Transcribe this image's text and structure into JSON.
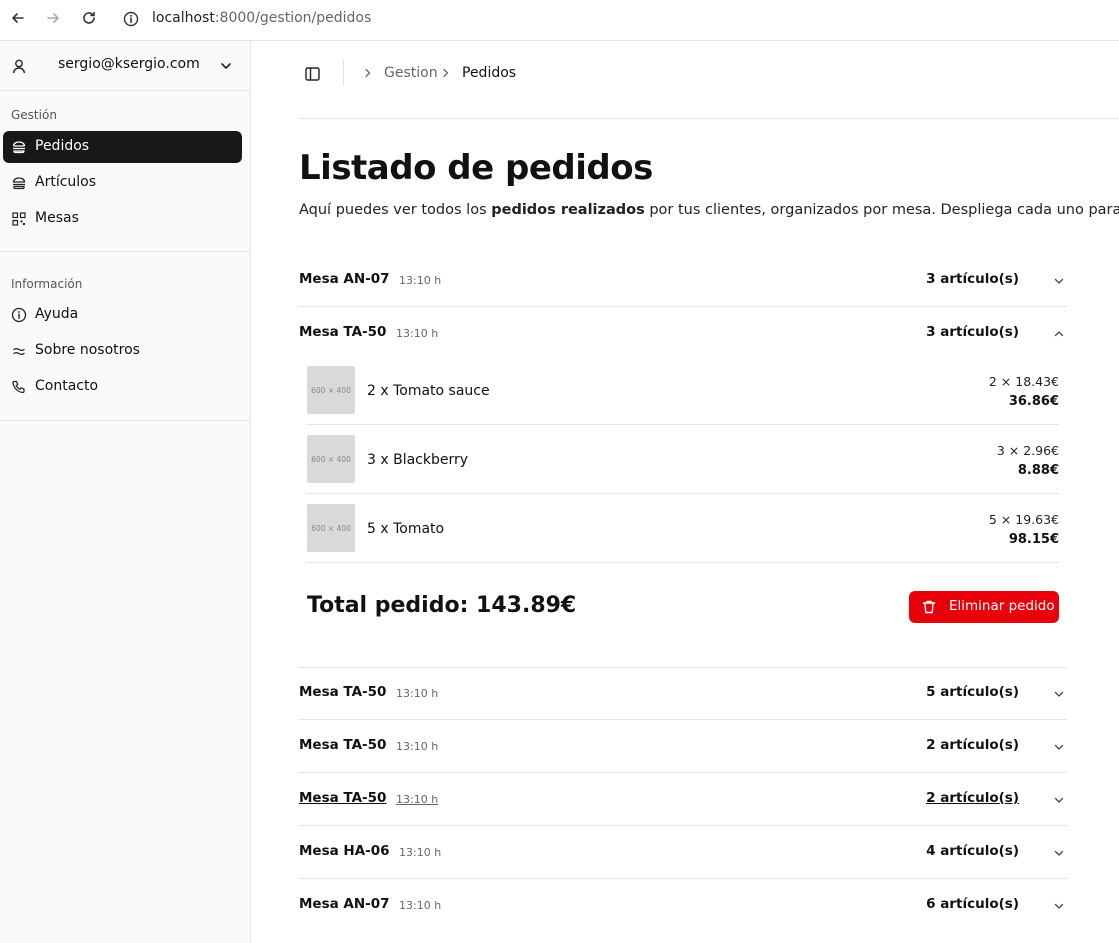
{
  "browser": {
    "url_host": "localhost",
    "url_path": ":8000/gestion/pedidos"
  },
  "sidebar": {
    "user_email": "sergio@ksergio.com",
    "groups": [
      {
        "label": "Gestión",
        "items": [
          {
            "label": "Pedidos",
            "icon": "hamburger-icon",
            "active": true
          },
          {
            "label": "Artículos",
            "icon": "burger-icon",
            "active": false
          },
          {
            "label": "Mesas",
            "icon": "qr-code-icon",
            "active": false
          }
        ]
      },
      {
        "label": "Información",
        "items": [
          {
            "label": "Ayuda",
            "icon": "info-icon",
            "active": false
          },
          {
            "label": "Sobre nosotros",
            "icon": "approx-icon",
            "active": false
          },
          {
            "label": "Contacto",
            "icon": "phone-icon",
            "active": false
          }
        ]
      }
    ]
  },
  "breadcrumb": [
    "Gestion",
    "Pedidos"
  ],
  "page": {
    "title": "Listado de pedidos",
    "desc_pre": "Aquí puedes ver todos los ",
    "desc_bold": "pedidos realizados",
    "desc_post": " por tus clientes, organizados por mesa. Despliega cada uno para ver s"
  },
  "orders": [
    {
      "mesa": "Mesa AN-07",
      "time": "13:10 h",
      "count": "3 artículo(s)",
      "expanded": false
    },
    {
      "mesa": "Mesa TA-50",
      "time": "13:10 h",
      "count": "3 artículo(s)",
      "expanded": true,
      "items": [
        {
          "thumb": "600 × 400",
          "name": "2 x Tomato sauce",
          "qty": "2 × 18.43€",
          "subtotal": "36.86€"
        },
        {
          "thumb": "600 × 400",
          "name": "3 x Blackberry",
          "qty": "3 × 2.96€",
          "subtotal": "8.88€"
        },
        {
          "thumb": "600 × 400",
          "name": "5 x Tomato",
          "qty": "5 × 19.63€",
          "subtotal": "98.15€"
        }
      ],
      "total": "Total pedido: 143.89€",
      "delete_label": "Eliminar pedido"
    },
    {
      "mesa": "Mesa TA-50",
      "time": "13:10 h",
      "count": "5 artículo(s)",
      "expanded": false
    },
    {
      "mesa": "Mesa TA-50",
      "time": "13:10 h",
      "count": "2 artículo(s)",
      "expanded": false
    },
    {
      "mesa": "Mesa TA-50",
      "time": "13:10 h",
      "count": "2 artículo(s)",
      "expanded": false,
      "hovered": true
    },
    {
      "mesa": "Mesa HA-06",
      "time": "13:10 h",
      "count": "4 artículo(s)",
      "expanded": false
    },
    {
      "mesa": "Mesa AN-07",
      "time": "13:10 h",
      "count": "6 artículo(s)",
      "expanded": false
    }
  ],
  "colors": {
    "accent_dark": "#18181b",
    "danger": "#e8000b",
    "border": "#e5e5e5"
  }
}
